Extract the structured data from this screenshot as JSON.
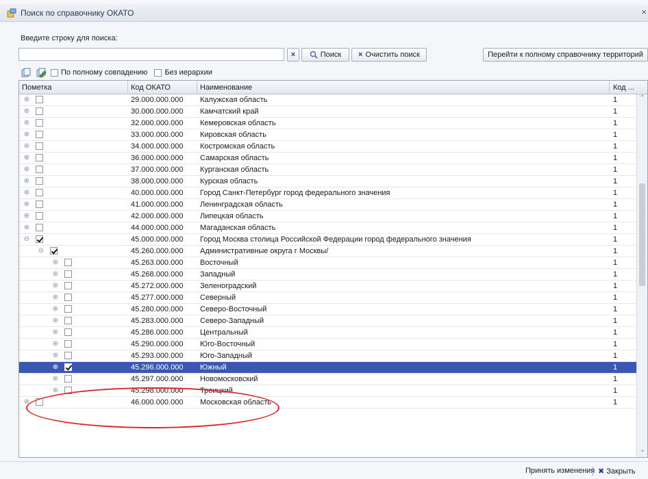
{
  "window": {
    "title": "Поиск по справочнику ОКАТО",
    "close_glyph": "×"
  },
  "search": {
    "label": "Введите строку для поиска:",
    "value": "",
    "clear_x": "×",
    "search_button": "Поиск",
    "clear_button": "Очистить поиск",
    "goto_button": "Перейти к полному справочнику территорий"
  },
  "options": {
    "exact_match_label": "По полному совпадению",
    "no_hierarchy_label": "Без иерархии"
  },
  "grid": {
    "columns": {
      "mark": "Пометка",
      "code": "Код ОКАТО",
      "name": "Наименование",
      "kod": "Код ..."
    },
    "rows": [
      {
        "level": 0,
        "expander": "⊕",
        "checked": false,
        "code": "29.000.000.000",
        "name": "Калужская область",
        "kod": "1"
      },
      {
        "level": 0,
        "expander": "⊕",
        "checked": false,
        "code": "30.000.000.000",
        "name": "Камчатский край",
        "kod": "1"
      },
      {
        "level": 0,
        "expander": "⊕",
        "checked": false,
        "code": "32.000.000.000",
        "name": "Кемеровская область",
        "kod": "1"
      },
      {
        "level": 0,
        "expander": "⊕",
        "checked": false,
        "code": "33.000.000.000",
        "name": "Кировская область",
        "kod": "1"
      },
      {
        "level": 0,
        "expander": "⊕",
        "checked": false,
        "code": "34.000.000.000",
        "name": "Костромская область",
        "kod": "1"
      },
      {
        "level": 0,
        "expander": "⊕",
        "checked": false,
        "code": "36.000.000.000",
        "name": "Самарская область",
        "kod": "1"
      },
      {
        "level": 0,
        "expander": "⊕",
        "checked": false,
        "code": "37.000.000.000",
        "name": "Курганская область",
        "kod": "1"
      },
      {
        "level": 0,
        "expander": "⊕",
        "checked": false,
        "code": "38.000.000.000",
        "name": "Курская область",
        "kod": "1"
      },
      {
        "level": 0,
        "expander": "⊕",
        "checked": false,
        "code": "40.000.000.000",
        "name": "Город Санкт-Петербург город федерального значения",
        "kod": "1"
      },
      {
        "level": 0,
        "expander": "⊕",
        "checked": false,
        "code": "41.000.000.000",
        "name": "Ленинградская область",
        "kod": "1"
      },
      {
        "level": 0,
        "expander": "⊕",
        "checked": false,
        "code": "42.000.000.000",
        "name": "Липецкая область",
        "kod": "1"
      },
      {
        "level": 0,
        "expander": "⊕",
        "checked": false,
        "code": "44.000.000.000",
        "name": "Магаданская область",
        "kod": "1"
      },
      {
        "level": 0,
        "expander": "⊖",
        "checked": true,
        "code": "45.000.000.000",
        "name": "Город Москва столица Российской Федерации город федерального значения",
        "kod": "1"
      },
      {
        "level": 1,
        "expander": "⊖",
        "checked": true,
        "code": "45.260.000.000",
        "name": "Административные округа г Москвы/",
        "kod": "1"
      },
      {
        "level": 2,
        "expander": "⊕",
        "checked": false,
        "code": "45.263.000.000",
        "name": "Восточный",
        "kod": "1"
      },
      {
        "level": 2,
        "expander": "⊕",
        "checked": false,
        "code": "45.268.000.000",
        "name": "Западный",
        "kod": "1"
      },
      {
        "level": 2,
        "expander": "⊕",
        "checked": false,
        "code": "45.272.000.000",
        "name": "Зеленоградский",
        "kod": "1"
      },
      {
        "level": 2,
        "expander": "⊕",
        "checked": false,
        "code": "45.277.000.000",
        "name": "Северный",
        "kod": "1"
      },
      {
        "level": 2,
        "expander": "⊕",
        "checked": false,
        "code": "45.280.000.000",
        "name": "Северо-Восточный",
        "kod": "1"
      },
      {
        "level": 2,
        "expander": "⊕",
        "checked": false,
        "code": "45.283.000.000",
        "name": "Северо-Западный",
        "kod": "1"
      },
      {
        "level": 2,
        "expander": "⊕",
        "checked": false,
        "code": "45.286.000.000",
        "name": "Центральный",
        "kod": "1"
      },
      {
        "level": 2,
        "expander": "⊕",
        "checked": false,
        "code": "45.290.000.000",
        "name": "Юго-Восточный",
        "kod": "1"
      },
      {
        "level": 2,
        "expander": "⊕",
        "checked": false,
        "code": "45.293.000.000",
        "name": "Юго-Западный",
        "kod": "1"
      },
      {
        "level": 2,
        "expander": "⊕",
        "checked": true,
        "code": "45.296.000.000",
        "name": "Южный",
        "kod": "1",
        "selected": true
      },
      {
        "level": 2,
        "expander": "⊕",
        "checked": false,
        "code": "45.297.000.000",
        "name": "Новомосковский",
        "kod": "1"
      },
      {
        "level": 2,
        "expander": "⊕",
        "checked": false,
        "code": "45.298.000.000",
        "name": "Троицкий",
        "kod": "1"
      },
      {
        "level": 0,
        "expander": "⊕",
        "checked": false,
        "code": "46.000.000.000",
        "name": "Московская область",
        "kod": "1"
      }
    ]
  },
  "footer": {
    "accept_label": "Принять изменения",
    "close_label": "Закрыть"
  },
  "colors": {
    "selection": "#3a57b2",
    "highlight_ring": "#e0262a",
    "accent_x": "#1d3f8f"
  },
  "icons": {
    "window": "window-icon",
    "search": "magnifier-icon",
    "add": "add-row-icon",
    "edit": "edit-row-icon"
  }
}
